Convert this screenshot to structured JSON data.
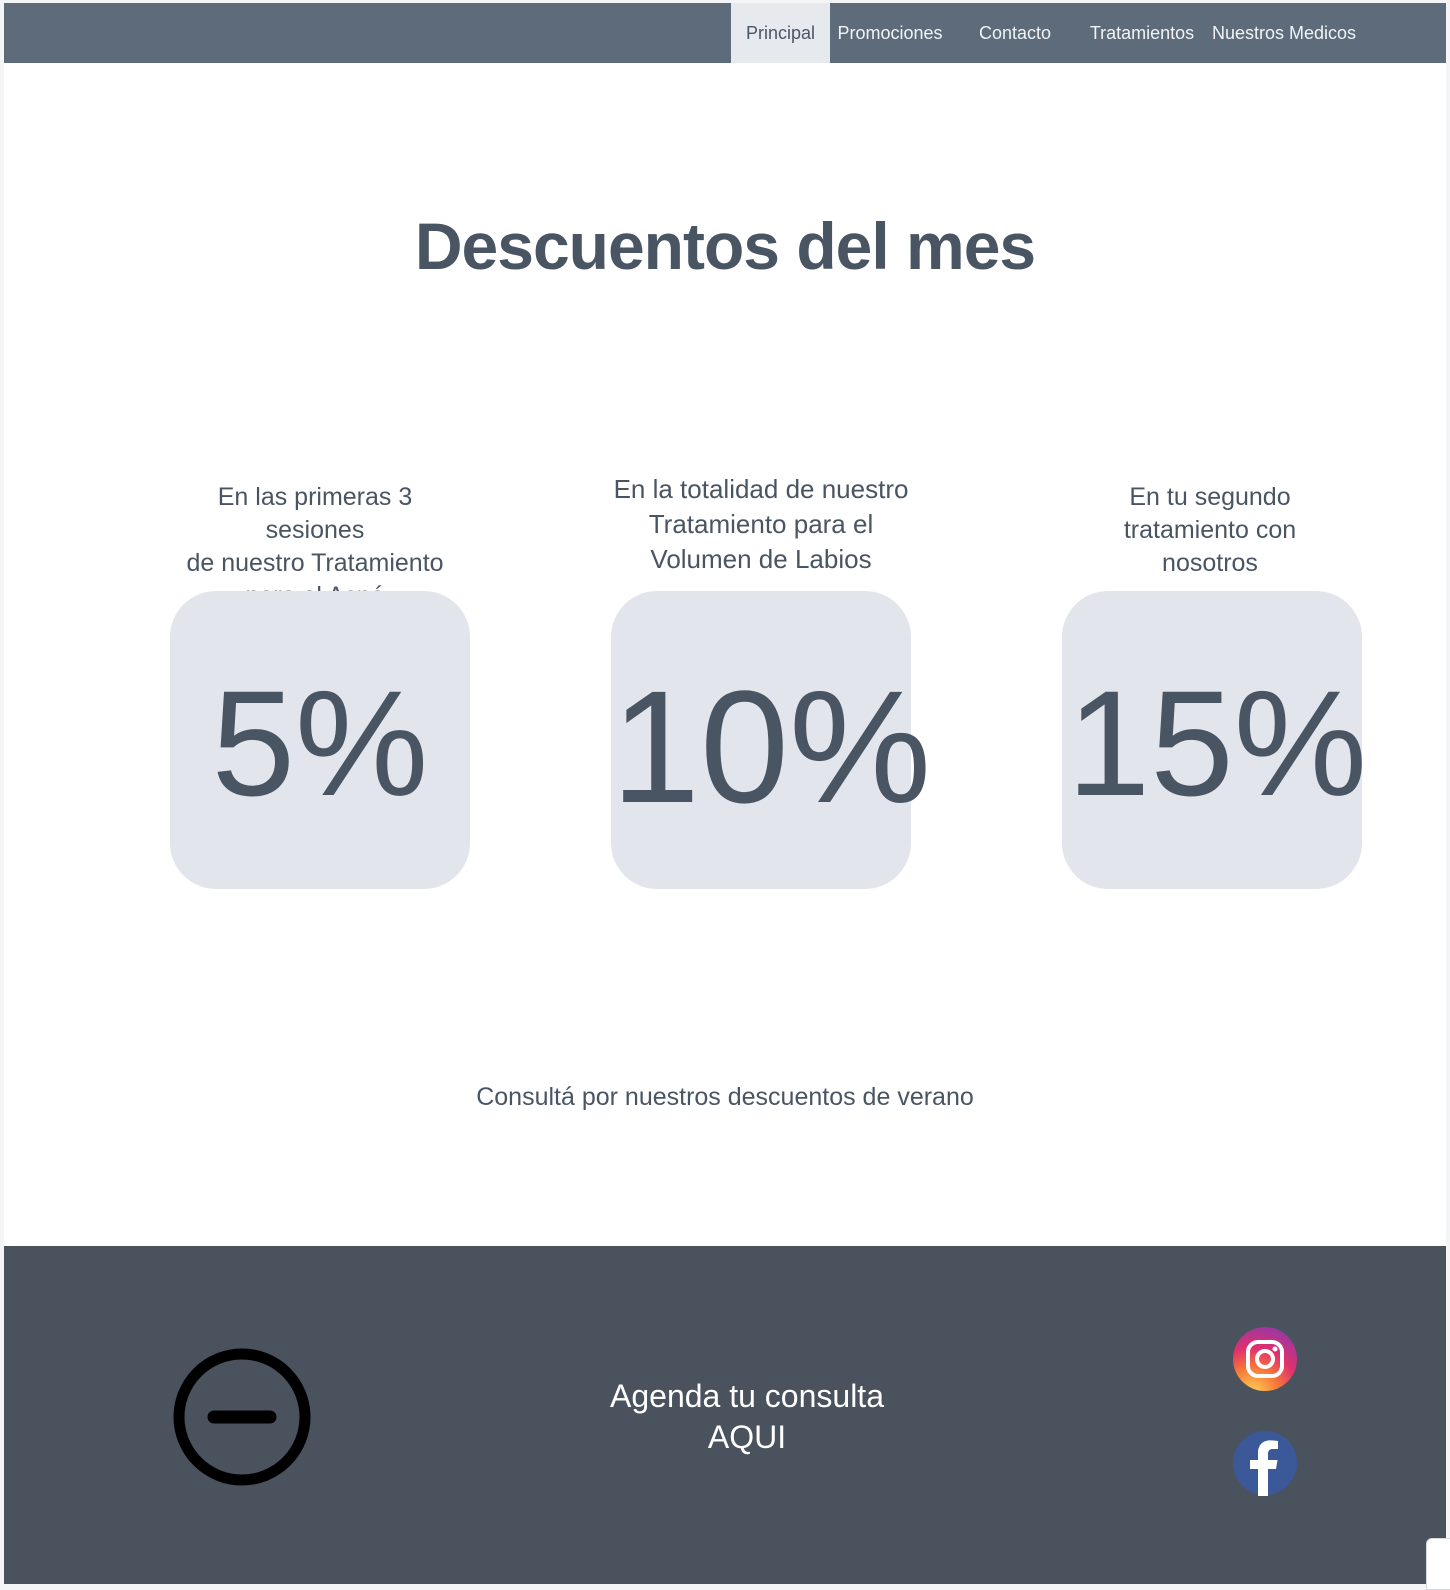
{
  "nav": {
    "items": [
      {
        "label": "Principal",
        "active": true
      },
      {
        "label": "Promociones"
      },
      {
        "label": "Contacto"
      },
      {
        "label": "Tratamientos"
      },
      {
        "label": "Nuestros Medicos"
      }
    ]
  },
  "main": {
    "title": "Descuentos del mes",
    "offers": [
      {
        "caption": [
          "En las primeras 3 sesiones",
          "de nuestro Tratamiento",
          "para el Acné"
        ],
        "value": "5%"
      },
      {
        "caption": [
          "En la totalidad de nuestro",
          "Tratamiento para el",
          "Volumen de Labios"
        ],
        "value": "10%"
      },
      {
        "caption": [
          "En tu segundo",
          "tratamiento con",
          "nosotros"
        ],
        "value": "15%"
      }
    ],
    "note": "Consultá por nuestros descuentos de verano"
  },
  "footer": {
    "logo_icon": "circle-minus-icon",
    "cta": [
      "Agenda tu consulta",
      "AQUI"
    ],
    "social": [
      {
        "icon": "instagram-icon",
        "colors": [
          "#f9ce34",
          "#ee2a7b",
          "#6228d7"
        ]
      },
      {
        "icon": "facebook-icon",
        "color": "#3b5998"
      }
    ]
  },
  "colors": {
    "navbar": "#5e6b7b",
    "nav_active": "#e6e9ee",
    "card": "#e2e5eb",
    "text": "#4a5563",
    "footer": "#4a525e"
  }
}
